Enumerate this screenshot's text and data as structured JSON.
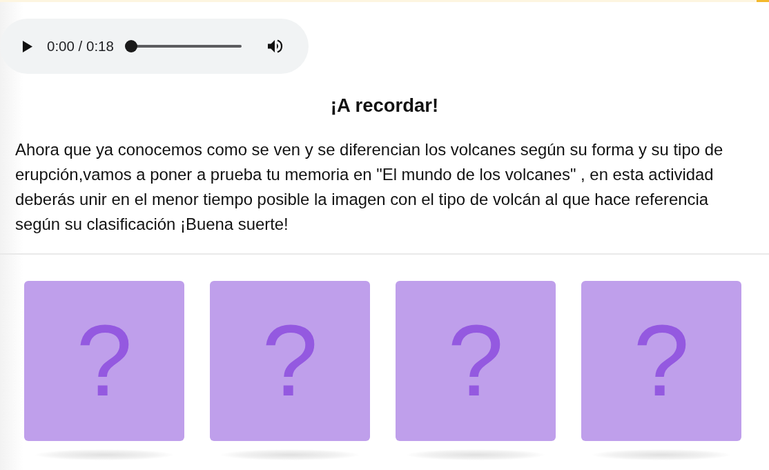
{
  "audio_player": {
    "playing": false,
    "time": "0:00 / 0:18",
    "level": 0
  },
  "heading": "¡A recordar!",
  "paragraph": "Ahora que ya conocemos como se ven y se diferencian los volcanes según su forma y su tipo de erupción,vamos a poner a prueba tu memoria en \"El mundo de los volcanes\" , en esta actividad deberás unir en el menor tiempo posible la imagen con el tipo de volcán al que hace referencia según su clasificación ¡Buena suerte!",
  "cards": [
    {
      "label": "?"
    },
    {
      "label": "?"
    },
    {
      "label": "?"
    },
    {
      "label": "?"
    }
  ]
}
